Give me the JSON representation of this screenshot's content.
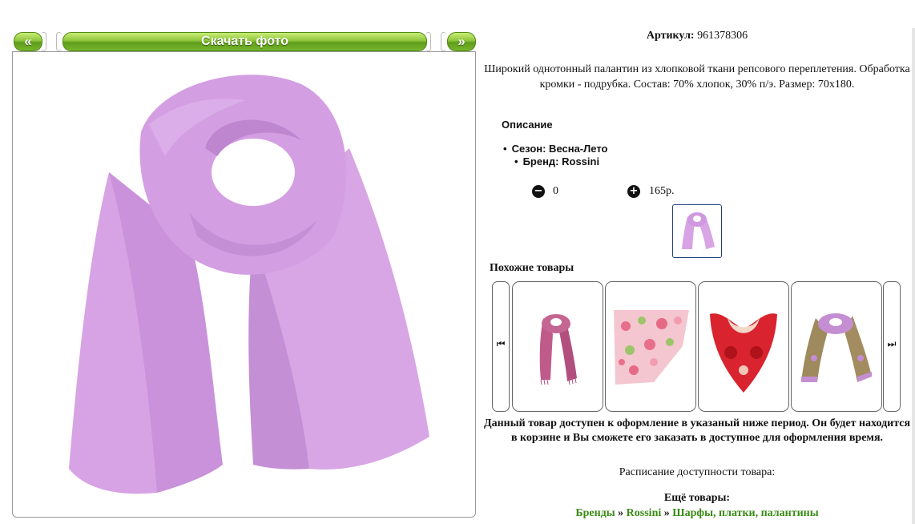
{
  "nav": {
    "prev_label": "«",
    "download_label": "Скачать фото",
    "next_label": "»"
  },
  "product": {
    "article_label": "Артикул:",
    "article_value": "961378306",
    "description": "Широкий однотонный палантин из хлопковой ткани репсового переплетения. Обработка кромки - подрубка. Состав: 70% хлопок, 30% п/э. Размер: 70х180.",
    "description_heading": "Описание",
    "properties": [
      "Сезон: Весна-Лето",
      "Бренд: Rossini"
    ],
    "quantity": "0",
    "price": "165р.",
    "color_main": "#d9a6e6"
  },
  "icons": {
    "minus": "minus-circle-icon",
    "plus": "plus-circle-icon",
    "carousel_prev": "skip-previous-icon",
    "carousel_next": "skip-next-icon"
  },
  "similar": {
    "heading": "Похожие товары",
    "items": [
      {
        "name": "pink-scarf",
        "color": "#c05a8a"
      },
      {
        "name": "floral-shawl",
        "color": "#f0a9b9"
      },
      {
        "name": "red-paisley-shawl",
        "color": "#d9232f"
      },
      {
        "name": "lilac-paisley-scarf",
        "color": "#c58ed2"
      }
    ]
  },
  "notice": "Данный товар доступен к оформление в указаный ниже период. Он будет находится в корзине и Вы сможете его заказать в доступное для оформления время.",
  "schedule_label": "Расписание доступности товара:",
  "more": {
    "heading": "Ещё товары:",
    "crumbs": [
      "Бренды",
      "Rossini",
      "Шарфы, платки, палантины"
    ],
    "separator": "»"
  }
}
